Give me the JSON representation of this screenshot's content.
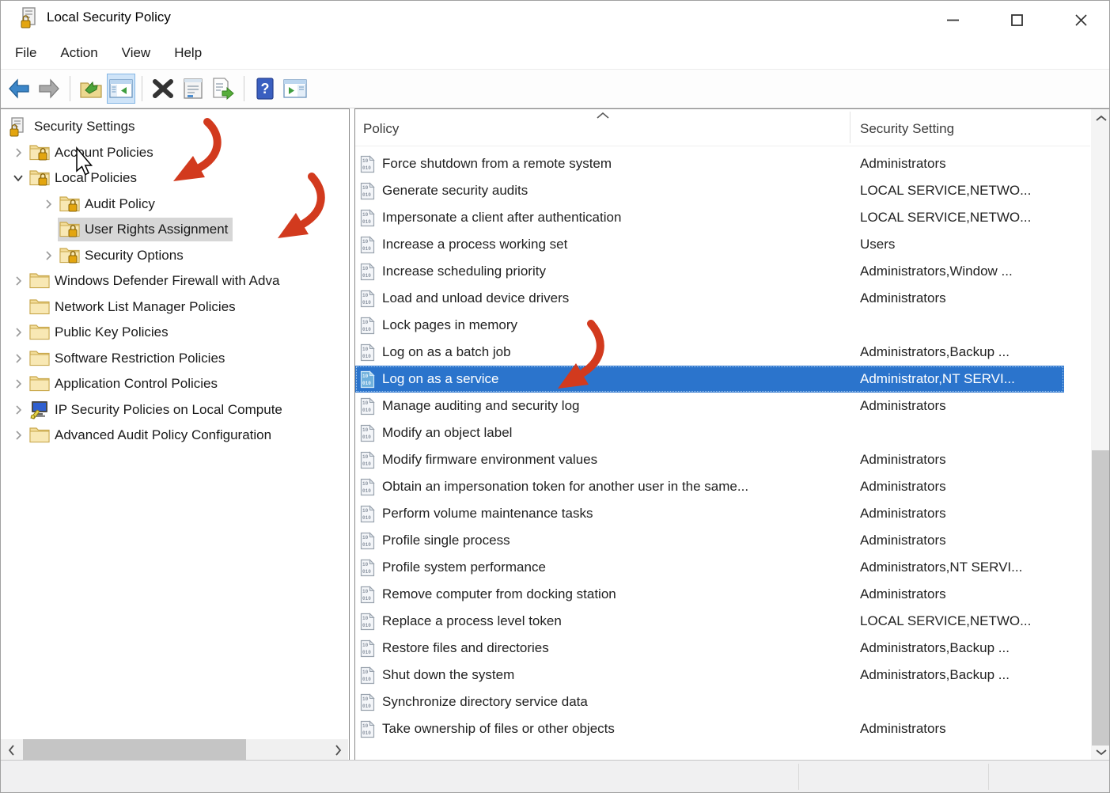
{
  "window": {
    "title": "Local Security Policy",
    "controls": [
      "minimize",
      "maximize",
      "close"
    ]
  },
  "menu": {
    "items": [
      "File",
      "Action",
      "View",
      "Help"
    ]
  },
  "toolbar": {
    "buttons": [
      {
        "name": "back",
        "enabled": true
      },
      {
        "name": "forward",
        "enabled": false
      },
      {
        "name": "up-one-level"
      },
      {
        "name": "show-console-tree",
        "active": true
      },
      {
        "name": "delete"
      },
      {
        "name": "properties"
      },
      {
        "name": "export-list"
      },
      {
        "name": "help"
      },
      {
        "name": "show-action-pane"
      }
    ]
  },
  "tree": {
    "items": [
      {
        "label": "Security Settings",
        "level": 0,
        "chevron": "none",
        "icon": "root",
        "selected": false
      },
      {
        "label": "Account Policies",
        "level": 1,
        "chevron": "collapsed",
        "icon": "folder-lock",
        "selected": false
      },
      {
        "label": "Local Policies",
        "level": 1,
        "chevron": "expanded",
        "icon": "folder-lock",
        "selected": false
      },
      {
        "label": "Audit Policy",
        "level": 2,
        "chevron": "collapsed",
        "icon": "folder-lock",
        "selected": false
      },
      {
        "label": "User Rights Assignment",
        "level": 2,
        "chevron": "none",
        "icon": "folder-lock",
        "selected": true
      },
      {
        "label": "Security Options",
        "level": 2,
        "chevron": "collapsed",
        "icon": "folder-lock",
        "selected": false
      },
      {
        "label": "Windows Defender Firewall with Adva",
        "level": 1,
        "chevron": "collapsed",
        "icon": "folder",
        "selected": false
      },
      {
        "label": "Network List Manager Policies",
        "level": 1,
        "chevron": "none",
        "icon": "folder",
        "selected": false
      },
      {
        "label": "Public Key Policies",
        "level": 1,
        "chevron": "collapsed",
        "icon": "folder",
        "selected": false
      },
      {
        "label": "Software Restriction Policies",
        "level": 1,
        "chevron": "collapsed",
        "icon": "folder",
        "selected": false
      },
      {
        "label": "Application Control Policies",
        "level": 1,
        "chevron": "collapsed",
        "icon": "folder",
        "selected": false
      },
      {
        "label": "IP Security Policies on Local Compute",
        "level": 1,
        "chevron": "collapsed",
        "icon": "ipsec",
        "selected": false
      },
      {
        "label": "Advanced Audit Policy Configuration",
        "level": 1,
        "chevron": "collapsed",
        "icon": "folder",
        "selected": false
      }
    ]
  },
  "list": {
    "columns": [
      "Policy",
      "Security Setting"
    ],
    "sort_column": "Policy",
    "sort_ascending": true,
    "rows": [
      {
        "policy": "Force shutdown from a remote system",
        "setting": "Administrators",
        "selected": false
      },
      {
        "policy": "Generate security audits",
        "setting": "LOCAL SERVICE,NETWO...",
        "selected": false
      },
      {
        "policy": "Impersonate a client after authentication",
        "setting": "LOCAL SERVICE,NETWO...",
        "selected": false
      },
      {
        "policy": "Increase a process working set",
        "setting": "Users",
        "selected": false
      },
      {
        "policy": "Increase scheduling priority",
        "setting": "Administrators,Window ...",
        "selected": false
      },
      {
        "policy": "Load and unload device drivers",
        "setting": "Administrators",
        "selected": false
      },
      {
        "policy": "Lock pages in memory",
        "setting": "",
        "selected": false
      },
      {
        "policy": "Log on as a batch job",
        "setting": "Administrators,Backup ...",
        "selected": false
      },
      {
        "policy": "Log on as a service",
        "setting": "Administrator,NT SERVI...",
        "selected": true
      },
      {
        "policy": "Manage auditing and security log",
        "setting": "Administrators",
        "selected": false
      },
      {
        "policy": "Modify an object label",
        "setting": "",
        "selected": false
      },
      {
        "policy": "Modify firmware environment values",
        "setting": "Administrators",
        "selected": false
      },
      {
        "policy": "Obtain an impersonation token for another user in the same...",
        "setting": "Administrators",
        "selected": false
      },
      {
        "policy": "Perform volume maintenance tasks",
        "setting": "Administrators",
        "selected": false
      },
      {
        "policy": "Profile single process",
        "setting": "Administrators",
        "selected": false
      },
      {
        "policy": "Profile system performance",
        "setting": "Administrators,NT SERVI...",
        "selected": false
      },
      {
        "policy": "Remove computer from docking station",
        "setting": "Administrators",
        "selected": false
      },
      {
        "policy": "Replace a process level token",
        "setting": "LOCAL SERVICE,NETWO...",
        "selected": false
      },
      {
        "policy": "Restore files and directories",
        "setting": "Administrators,Backup ...",
        "selected": false
      },
      {
        "policy": "Shut down the system",
        "setting": "Administrators,Backup ...",
        "selected": false
      },
      {
        "policy": "Synchronize directory service data",
        "setting": "",
        "selected": false
      },
      {
        "policy": "Take ownership of files or other objects",
        "setting": "Administrators",
        "selected": false
      }
    ]
  },
  "annotations": {
    "arrow_color": "#d23a1e",
    "arrows": [
      {
        "target": "Local Policies"
      },
      {
        "target": "User Rights Assignment"
      },
      {
        "target": "Log on as a service"
      }
    ],
    "cursor_over": "Account Policies"
  },
  "statusbar": {
    "sections": [
      "",
      "",
      ""
    ]
  }
}
